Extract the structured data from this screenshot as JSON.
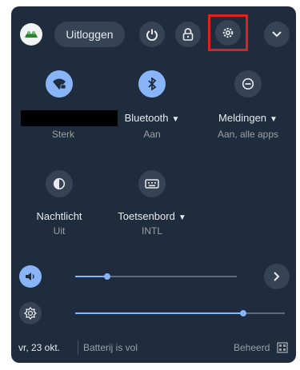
{
  "header": {
    "avatar_icon": "avatar-frog-icon",
    "signout_label": "Uitloggen",
    "power_icon": "power-icon",
    "lock_icon": "lock-icon",
    "settings_icon": "gear-icon",
    "collapse_icon": "chevron-down-icon"
  },
  "tiles": [
    {
      "id": "network",
      "icon": "wifi-lock-icon",
      "label": "",
      "status": "Sterk",
      "active": true
    },
    {
      "id": "bluetooth",
      "icon": "bluetooth-icon",
      "label": "Bluetooth",
      "status": "Aan",
      "active": true
    },
    {
      "id": "notifications",
      "icon": "do-not-disturb-icon",
      "label": "Meldingen",
      "status": "Aan, alle apps",
      "active": false
    },
    {
      "id": "nightlight",
      "icon": "night-light-icon",
      "label": "Nachtlicht",
      "status": "Uit",
      "active": false
    },
    {
      "id": "keyboard",
      "icon": "keyboard-icon",
      "label": "Toetsenbord",
      "status": "INTL",
      "active": false
    }
  ],
  "sliders": {
    "volume": {
      "icon": "volume-icon",
      "level": 0.2
    },
    "brightness": {
      "icon": "brightness-icon",
      "level": 0.8
    }
  },
  "footer": {
    "date": "vr, 23 okt.",
    "battery": "Batterij is vol",
    "managed": "Beheerd",
    "managed_icon": "building-icon"
  },
  "colors": {
    "panel_bg": "#1f2c3d",
    "accent": "#8ab4f8",
    "highlight_box": "#e0201c"
  }
}
